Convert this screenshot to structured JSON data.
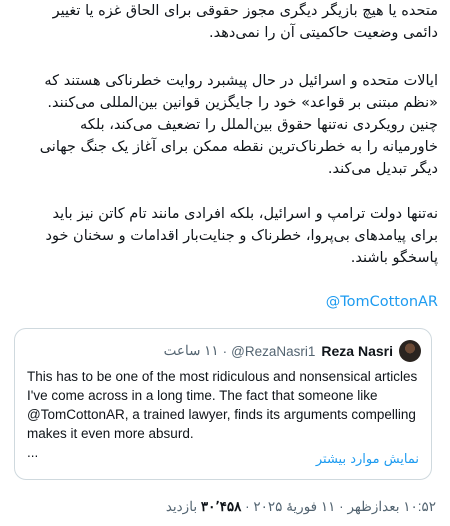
{
  "tweet": {
    "paragraph1": "متحده یا هیچ بازیگر دیگری مجوز حقوقی برای الحاق غزه یا تغییر دائمی وضعیت حاکمیتی آن را نمی‌دهد.",
    "paragraph2": "ایالات متحده و اسرائیل در حال پیشبرد روایت خطرناکی هستند که «نظم مبتنی بر قواعد» خود را جایگزین قوانین بین‌المللی می‌کنند. چنین رویکردی نه‌تنها حقوق بین‌الملل را تضعیف می‌کند، بلکه خاورمیانه را به خطرناک‌ترین نقطه ممکن برای آغاز یک جنگ جهانی دیگر تبدیل می‌کند.",
    "paragraph3": "نه‌تنها دولت ترامپ و اسرائیل، بلکه افرادی مانند تام کاتن نیز باید برای پیامدهای بی‌پروا، خطرناک و جنایت‌بار اقدامات و سخنان خود پاسخگو باشند.",
    "mention": "@TomCottonAR"
  },
  "quote": {
    "name": "Reza Nasri",
    "handle": "@RezaNasri1",
    "separator": "·",
    "time": "۱۱ ساعت",
    "text": "This has to be one of the most ridiculous and nonsensical articles I've come across in a long time. The fact that someone like @TomCottonAR, a trained lawyer, finds its arguments compelling makes it even more absurd.",
    "ellipsis": "...",
    "show_more": "نمایش موارد بیشتر"
  },
  "meta": {
    "time": "۱۰:۵۲ بعدازظهر",
    "sep1": "·",
    "date": "۱۱ فوریهٔ ۲۰۲۵",
    "sep2": "·",
    "views": "۳۰٬۴۵۸",
    "views_label": "بازدید"
  }
}
